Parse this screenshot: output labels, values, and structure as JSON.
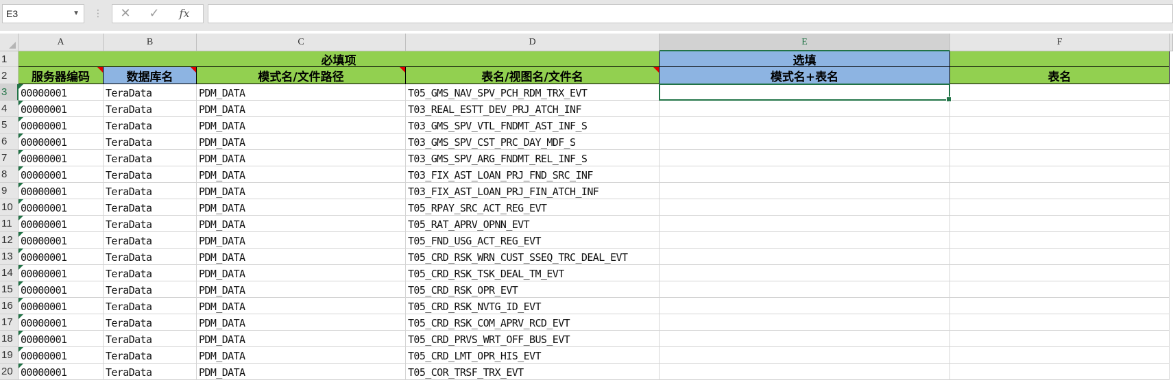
{
  "formula_bar": {
    "name_box": "E3",
    "cancel_icon": "close-icon",
    "enter_icon": "check-icon",
    "fx_label": "fx",
    "formula": ""
  },
  "columns": [
    "A",
    "B",
    "C",
    "D",
    "E",
    "F"
  ],
  "selected_cell": "E3",
  "header_rows": {
    "row1": {
      "required": "必填项",
      "optional": "选填",
      "blank": ""
    },
    "row2": {
      "server_code": "服务器编码",
      "db_name": "数据库名",
      "schema_path": "模式名/文件路径",
      "table_name": "表名/视图名/文件名",
      "schema_table": "模式名+表名",
      "table": "表名"
    }
  },
  "row_numbers": [
    "1",
    "2",
    "3",
    "4",
    "5",
    "6",
    "7",
    "8",
    "9",
    "10",
    "11",
    "12",
    "13",
    "14",
    "15",
    "16",
    "17",
    "18",
    "19",
    "20"
  ],
  "rows": [
    {
      "a": "00000001",
      "b": "TeraData",
      "c": "PDM_DATA",
      "d": "T05_GMS_NAV_SPV_PCH_RDM_TRX_EVT"
    },
    {
      "a": "00000001",
      "b": "TeraData",
      "c": "PDM_DATA",
      "d": "T03_REAL_ESTT_DEV_PRJ_ATCH_INF"
    },
    {
      "a": "00000001",
      "b": "TeraData",
      "c": "PDM_DATA",
      "d": "T03_GMS_SPV_VTL_FNDMT_AST_INF_S"
    },
    {
      "a": "00000001",
      "b": "TeraData",
      "c": "PDM_DATA",
      "d": "T03_GMS_SPV_CST_PRC_DAY_MDF_S"
    },
    {
      "a": "00000001",
      "b": "TeraData",
      "c": "PDM_DATA",
      "d": "T03_GMS_SPV_ARG_FNDMT_REL_INF_S"
    },
    {
      "a": "00000001",
      "b": "TeraData",
      "c": "PDM_DATA",
      "d": "T03_FIX_AST_LOAN_PRJ_FND_SRC_INF"
    },
    {
      "a": "00000001",
      "b": "TeraData",
      "c": "PDM_DATA",
      "d": "T03_FIX_AST_LOAN_PRJ_FIN_ATCH_INF"
    },
    {
      "a": "00000001",
      "b": "TeraData",
      "c": "PDM_DATA",
      "d": "T05_RPAY_SRC_ACT_REG_EVT"
    },
    {
      "a": "00000001",
      "b": "TeraData",
      "c": "PDM_DATA",
      "d": "T05_RAT_APRV_OPNN_EVT"
    },
    {
      "a": "00000001",
      "b": "TeraData",
      "c": "PDM_DATA",
      "d": "T05_FND_USG_ACT_REG_EVT"
    },
    {
      "a": "00000001",
      "b": "TeraData",
      "c": "PDM_DATA",
      "d": "T05_CRD_RSK_WRN_CUST_SSEQ_TRC_DEAL_EVT"
    },
    {
      "a": "00000001",
      "b": "TeraData",
      "c": "PDM_DATA",
      "d": "T05_CRD_RSK_TSK_DEAL_TM_EVT"
    },
    {
      "a": "00000001",
      "b": "TeraData",
      "c": "PDM_DATA",
      "d": "T05_CRD_RSK_OPR_EVT"
    },
    {
      "a": "00000001",
      "b": "TeraData",
      "c": "PDM_DATA",
      "d": "T05_CRD_RSK_NVTG_ID_EVT"
    },
    {
      "a": "00000001",
      "b": "TeraData",
      "c": "PDM_DATA",
      "d": "T05_CRD_RSK_COM_APRV_RCD_EVT"
    },
    {
      "a": "00000001",
      "b": "TeraData",
      "c": "PDM_DATA",
      "d": "T05_CRD_PRVS_WRT_OFF_BUS_EVT"
    },
    {
      "a": "00000001",
      "b": "TeraData",
      "c": "PDM_DATA",
      "d": "T05_CRD_LMT_OPR_HIS_EVT"
    },
    {
      "a": "00000001",
      "b": "TeraData",
      "c": "PDM_DATA",
      "d": "T05_COR_TRSF_TRX_EVT"
    }
  ],
  "colors": {
    "required_fill": "#92d050",
    "optional_fill": "#8db4e2",
    "selection": "#217346",
    "comment_marker": "#e00000"
  }
}
